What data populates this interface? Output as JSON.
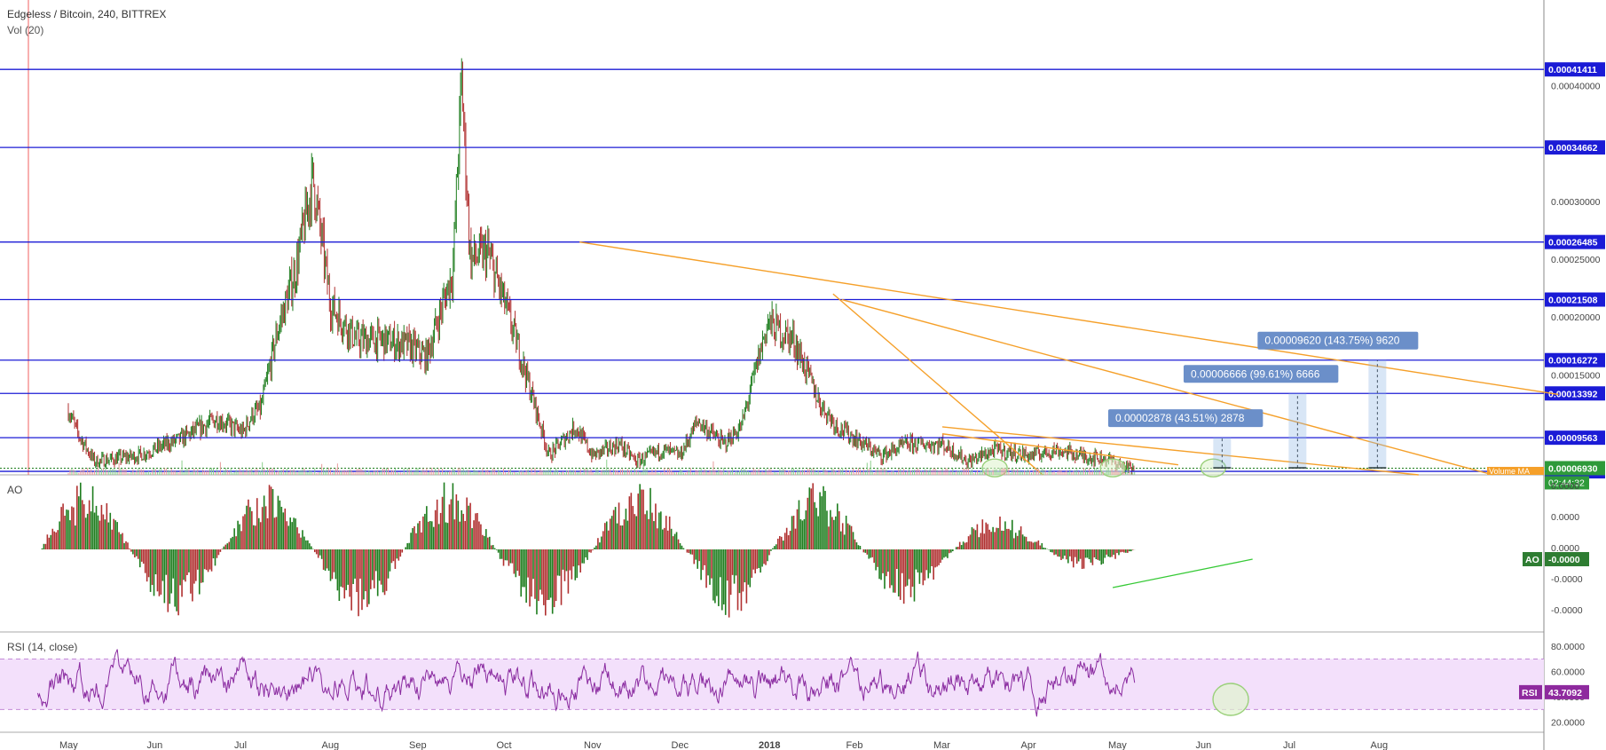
{
  "header": {
    "title": "Edgeless / Bitcoin, 240, BITTREX",
    "volume_label": "Vol (20)",
    "ao_label": "AO",
    "rsi_label": "RSI (14, close)",
    "volume_ma_label": "Volume MA"
  },
  "colors": {
    "level_line": "#1b1bd6",
    "trendline": "#f5a02a",
    "up": "#1e7d1e",
    "down": "#b03030",
    "rsi_line": "#8a2ba0",
    "rsi_band": "#f3e0fb",
    "projection": "#8fb6e6",
    "projection_label": "#6b8fc9",
    "circle": "#9ad07a"
  },
  "chart_data": [
    {
      "type": "candlestick",
      "title": "Edgeless / Bitcoin, 240, BITTREX",
      "x_ticks": [
        "May",
        "Jun",
        "Jul",
        "Aug",
        "Sep",
        "Oct",
        "Nov",
        "Dec",
        "2018",
        "Feb",
        "Mar",
        "Apr",
        "May",
        "Jun",
        "Jul",
        "Aug"
      ],
      "y_ticks": [
        "0.00040000",
        "0.00030000",
        "0.00025000",
        "0.00020000",
        "0.00015000"
      ],
      "ylim": [
        6.35e-05,
        0.000468
      ],
      "horizontal_levels": [
        "0.00041411",
        "0.00034662",
        "0.00026485",
        "0.00021508",
        "0.00016272",
        "0.00013392",
        "0.00009563",
        "0.00006653"
      ],
      "current_price": "0.00006930",
      "countdown": "02:44:32",
      "price_path_month_index": [
        0.0,
        0.1,
        0.3,
        0.8,
        1.3,
        1.7,
        2.0,
        2.1,
        2.2,
        2.4,
        2.6,
        2.8,
        3.0,
        3.3,
        3.6,
        3.9,
        4.1,
        4.4,
        4.5,
        4.6,
        4.8,
        5.0,
        5.2,
        5.5,
        5.8,
        6.0,
        6.3,
        6.5,
        6.8,
        7.0,
        7.2,
        7.5,
        7.7,
        8.0,
        8.3,
        8.6,
        8.8,
        9.0,
        9.3,
        9.6,
        10.0,
        10.3,
        10.6,
        11.0,
        11.3,
        11.6,
        11.9,
        12.1,
        12.2
      ],
      "price_path_values": [
        0.00012,
        0.0001,
        7.5e-05,
        8e-05,
        9.5e-05,
        0.000112,
        0.0001,
        0.000115,
        0.00012,
        0.00019,
        0.00024,
        0.00032,
        0.00021,
        0.00018,
        0.00018,
        0.000175,
        0.000165,
        0.00024,
        0.000405,
        0.00025,
        0.000255,
        0.00021,
        0.00016,
        8e-05,
        0.000105,
        8e-05,
        9e-05,
        7.5e-05,
        8.5e-05,
        8e-05,
        0.00011,
        9e-05,
        0.000105,
        0.000195,
        0.00018,
        0.000125,
        0.000105,
        9.5e-05,
        8e-05,
        9e-05,
        9e-05,
        7.5e-05,
        8.5e-05,
        8e-05,
        8.5e-05,
        8e-05,
        7.7e-05,
        7e-05,
        6.8e-05
      ],
      "trendlines": [
        {
          "start": [
            5.85,
            0.00026485
          ],
          "end": [
            17.05,
            0.000133
          ]
        },
        {
          "start": [
            8.75,
            0.00022
          ],
          "end": [
            11.15,
            6.35e-05
          ]
        },
        {
          "start": [
            10.0,
            0.000105
          ],
          "end": [
            15.45,
            6.35e-05
          ]
        },
        {
          "start": [
            8.85,
            0.00021508
          ],
          "end": [
            16.3,
            6.35e-05
          ]
        }
      ],
      "projections": [
        {
          "label": "0.00002878 (43.51%) 2878",
          "target": 9.563e-05
        },
        {
          "label": "0.00006666 (99.61%) 6666",
          "target": 0.00013392
        },
        {
          "label": "0.00009620 (143.75%) 9620",
          "target": 0.00016272
        }
      ],
      "marked_lows_month_index": [
        10.6,
        11.95,
        13.1
      ]
    },
    {
      "type": "bar",
      "title": "AO",
      "y_ticks": [
        "0.0000",
        "0.0000",
        "0.0000",
        "-0.0000",
        "-0.0000"
      ],
      "current_value": "-0.0000"
    },
    {
      "type": "line",
      "title": "RSI (14, close)",
      "y_ticks": [
        "80.0000",
        "60.0000",
        "40.0000",
        "20.0000"
      ],
      "ylim": [
        12,
        90
      ],
      "band": [
        30,
        70
      ],
      "current_value": "43.7092"
    }
  ]
}
